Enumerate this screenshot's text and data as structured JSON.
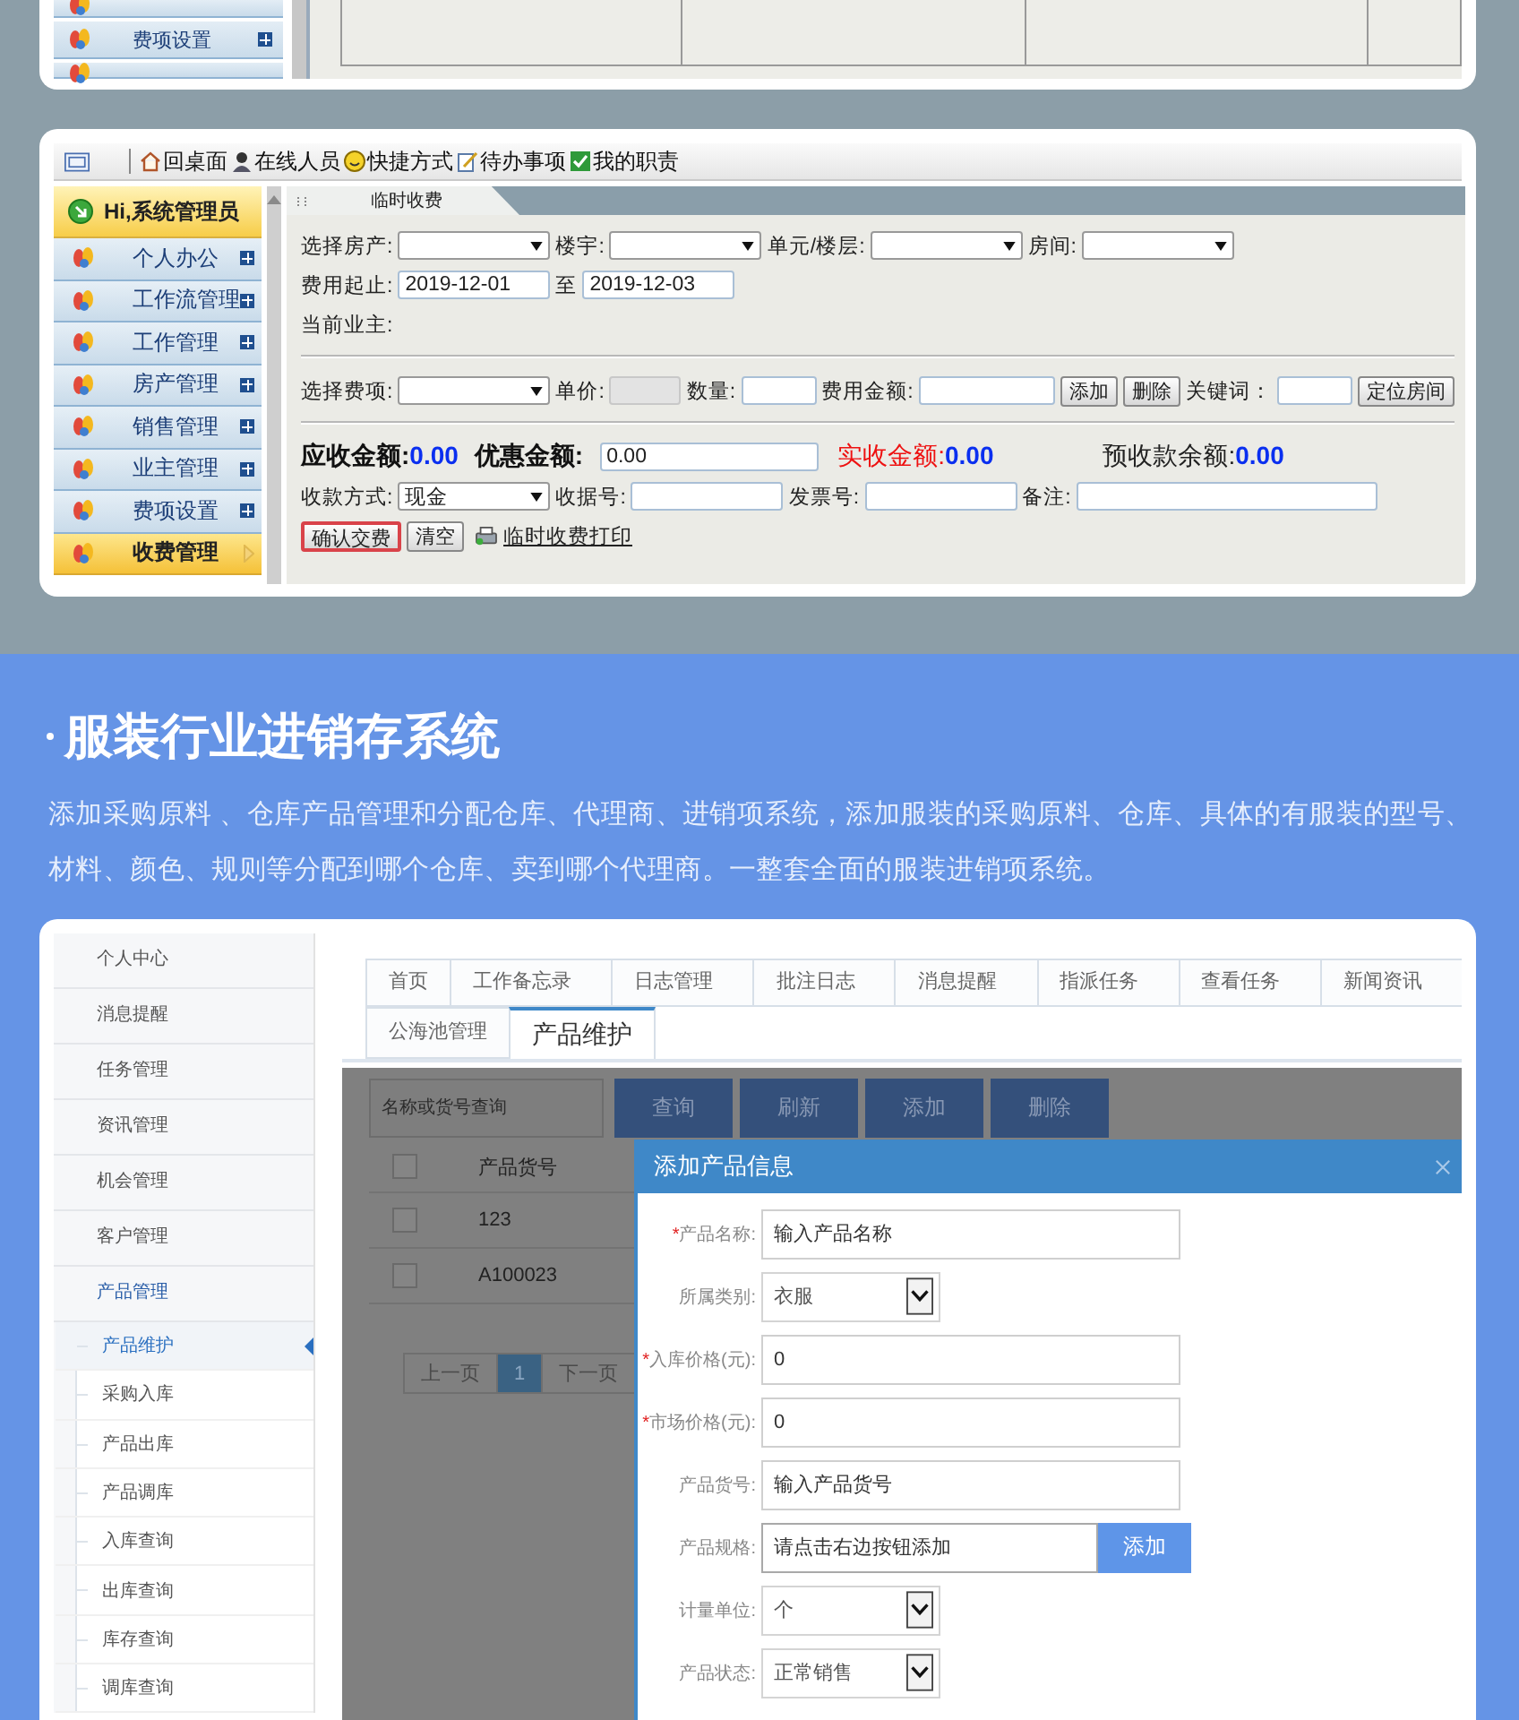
{
  "top_panel": {
    "menu": [
      {
        "label": "费项设置"
      }
    ]
  },
  "fee_app": {
    "toolbar": [
      {
        "label": "回桌面",
        "kind": "home"
      },
      {
        "label": "在线人员",
        "kind": "people"
      },
      {
        "label": "快捷方式",
        "kind": "smile"
      },
      {
        "label": "待办事项",
        "kind": "note"
      },
      {
        "label": "我的职责",
        "kind": "check"
      }
    ],
    "greeting": "Hi,系统管理员",
    "menu": [
      {
        "label": "个人办公",
        "selected": false
      },
      {
        "label": "工作流管理",
        "selected": false
      },
      {
        "label": "工作管理",
        "selected": false
      },
      {
        "label": "房产管理",
        "selected": false
      },
      {
        "label": "销售管理",
        "selected": false
      },
      {
        "label": "业主管理",
        "selected": false
      },
      {
        "label": "费项设置",
        "selected": false
      },
      {
        "label": "收费管理",
        "selected": true
      }
    ],
    "tab": "临时收费",
    "sections": [
      {
        "rows": [
          {
            "items": [
              {
                "kind": "label",
                "text": "选择房产:"
              },
              {
                "kind": "select"
              },
              {
                "kind": "label",
                "text": "楼宇:"
              },
              {
                "kind": "select"
              },
              {
                "kind": "label",
                "text": "单元/楼层:"
              },
              {
                "kind": "select"
              },
              {
                "kind": "label",
                "text": "房间:"
              },
              {
                "kind": "select"
              }
            ]
          },
          {
            "items": [
              {
                "kind": "label",
                "text": "费用起止:"
              },
              {
                "kind": "input",
                "value": "2019-12-01"
              },
              {
                "kind": "label",
                "text": "至"
              },
              {
                "kind": "input",
                "value": "2019-12-03"
              }
            ]
          },
          {
            "items": [
              {
                "kind": "label",
                "text": "当前业主:"
              }
            ]
          }
        ]
      },
      {
        "rows": [
          {
            "items": [
              {
                "kind": "label",
                "text": "选择费项:"
              },
              {
                "kind": "select"
              },
              {
                "kind": "label",
                "text": "单价:"
              },
              {
                "kind": "disabled_input"
              },
              {
                "kind": "label",
                "text": "数量:"
              },
              {
                "kind": "input"
              },
              {
                "kind": "label",
                "text": "费用金额:"
              },
              {
                "kind": "input"
              },
              {
                "kind": "button",
                "text": "添加",
                "primary": false
              },
              {
                "kind": "button",
                "text": "删除",
                "primary": false
              },
              {
                "kind": "label",
                "text": "关键词："
              },
              {
                "kind": "input"
              },
              {
                "kind": "button",
                "text": "定位房间",
                "primary": false
              }
            ]
          }
        ]
      },
      {
        "rows": [
          {
            "items": [
              {
                "kind": "strong_total",
                "text": "应收金额:",
                "value": "0.00"
              },
              {
                "kind": "strong_total",
                "text": "优惠金额:"
              },
              {
                "kind": "input",
                "value": "0.00"
              },
              {
                "kind": "alert_total",
                "text": "实收金额:",
                "value": "0.00"
              },
              {
                "kind": "plain_total",
                "text": "预收款余额:",
                "value": "0.00"
              }
            ]
          },
          {
            "items": [
              {
                "kind": "label",
                "text": "收款方式:"
              },
              {
                "kind": "select",
                "value": "现金"
              },
              {
                "kind": "label",
                "text": "收据号:"
              },
              {
                "kind": "input"
              },
              {
                "kind": "label",
                "text": "发票号:"
              },
              {
                "kind": "input"
              },
              {
                "kind": "label",
                "text": "备注:"
              },
              {
                "kind": "input"
              }
            ]
          },
          {
            "items": [
              {
                "kind": "button",
                "text": "确认交费",
                "primary": true
              },
              {
                "kind": "button",
                "text": "清空",
                "primary": false
              },
              {
                "kind": "print_link",
                "text": "临时收费打印"
              }
            ]
          }
        ]
      }
    ]
  },
  "feature": {
    "title": "服装行业进销存系统",
    "description": "添加采购原料 、仓库产品管理和分配仓库、代理商、进销项系统，添加服装的采购原料、仓库、具体的有服装的型号、材料、颜色、规则等分配到哪个仓库、卖到哪个代理商。一整套全面的服装进销项系统。"
  },
  "inventory_app": {
    "menu": [
      {
        "label": "个人中心",
        "expanded": false
      },
      {
        "label": "消息提醒",
        "expanded": false
      },
      {
        "label": "任务管理",
        "expanded": false
      },
      {
        "label": "资讯管理",
        "expanded": false
      },
      {
        "label": "机会管理",
        "expanded": false
      },
      {
        "label": "客户管理",
        "expanded": false
      },
      {
        "label": "产品管理",
        "expanded": true,
        "children": [
          {
            "label": "产品维护",
            "selected": true
          },
          {
            "label": "采购入库",
            "selected": false
          },
          {
            "label": "产品出库",
            "selected": false
          },
          {
            "label": "产品调库",
            "selected": false
          },
          {
            "label": "入库查询",
            "selected": false
          },
          {
            "label": "出库查询",
            "selected": false
          },
          {
            "label": "库存查询",
            "selected": false
          },
          {
            "label": "调库查询",
            "selected": false
          }
        ]
      }
    ],
    "tab_rows": [
      {
        "tabs": [
          {
            "label": "首页",
            "selected": false
          },
          {
            "label": "工作备忘录",
            "selected": false
          },
          {
            "label": "日志管理",
            "selected": false
          },
          {
            "label": "批注日志",
            "selected": false
          },
          {
            "label": "消息提醒",
            "selected": false
          },
          {
            "label": "指派任务",
            "selected": false
          },
          {
            "label": "查看任务",
            "selected": false
          },
          {
            "label": "新闻资讯",
            "selected": false
          }
        ]
      },
      {
        "tabs": [
          {
            "label": "公海池管理",
            "selected": false
          },
          {
            "label": "产品维护",
            "selected": true
          }
        ]
      }
    ],
    "search": {
      "placeholder": "名称或货号查询"
    },
    "buttons": [
      "查询",
      "刷新",
      "添加",
      "删除"
    ],
    "table": {
      "columns": [
        "产品货号"
      ],
      "header_checked": false,
      "rows": [
        {
          "checked": false,
          "cells": [
            "123"
          ]
        },
        {
          "checked": false,
          "cells": [
            "A100023"
          ]
        }
      ]
    },
    "pagination": {
      "prev": "上一页",
      "pages": [
        {
          "label": "1",
          "selected": true
        }
      ],
      "next": "下一页"
    },
    "dialog": {
      "title": "添加产品信息",
      "fields": [
        {
          "required_mark": "*",
          "label": "产品名称:",
          "kind": "text",
          "value": "输入产品名称"
        },
        {
          "label": "所属类别:",
          "kind": "select",
          "value": "衣服"
        },
        {
          "required_mark": "*",
          "label": "入库价格(元):",
          "kind": "text",
          "value": "0"
        },
        {
          "required_mark": "*",
          "label": "市场价格(元):",
          "kind": "text",
          "value": "0"
        },
        {
          "label": "产品货号:",
          "kind": "text",
          "value": "输入产品货号"
        },
        {
          "label": "产品规格:",
          "kind": "text_button",
          "value": "请点击右边按钮添加",
          "button": "添加"
        },
        {
          "label": "计量单位:",
          "kind": "select",
          "value": "个"
        },
        {
          "label": "产品状态:",
          "kind": "select",
          "value": "正常销售"
        }
      ]
    }
  }
}
